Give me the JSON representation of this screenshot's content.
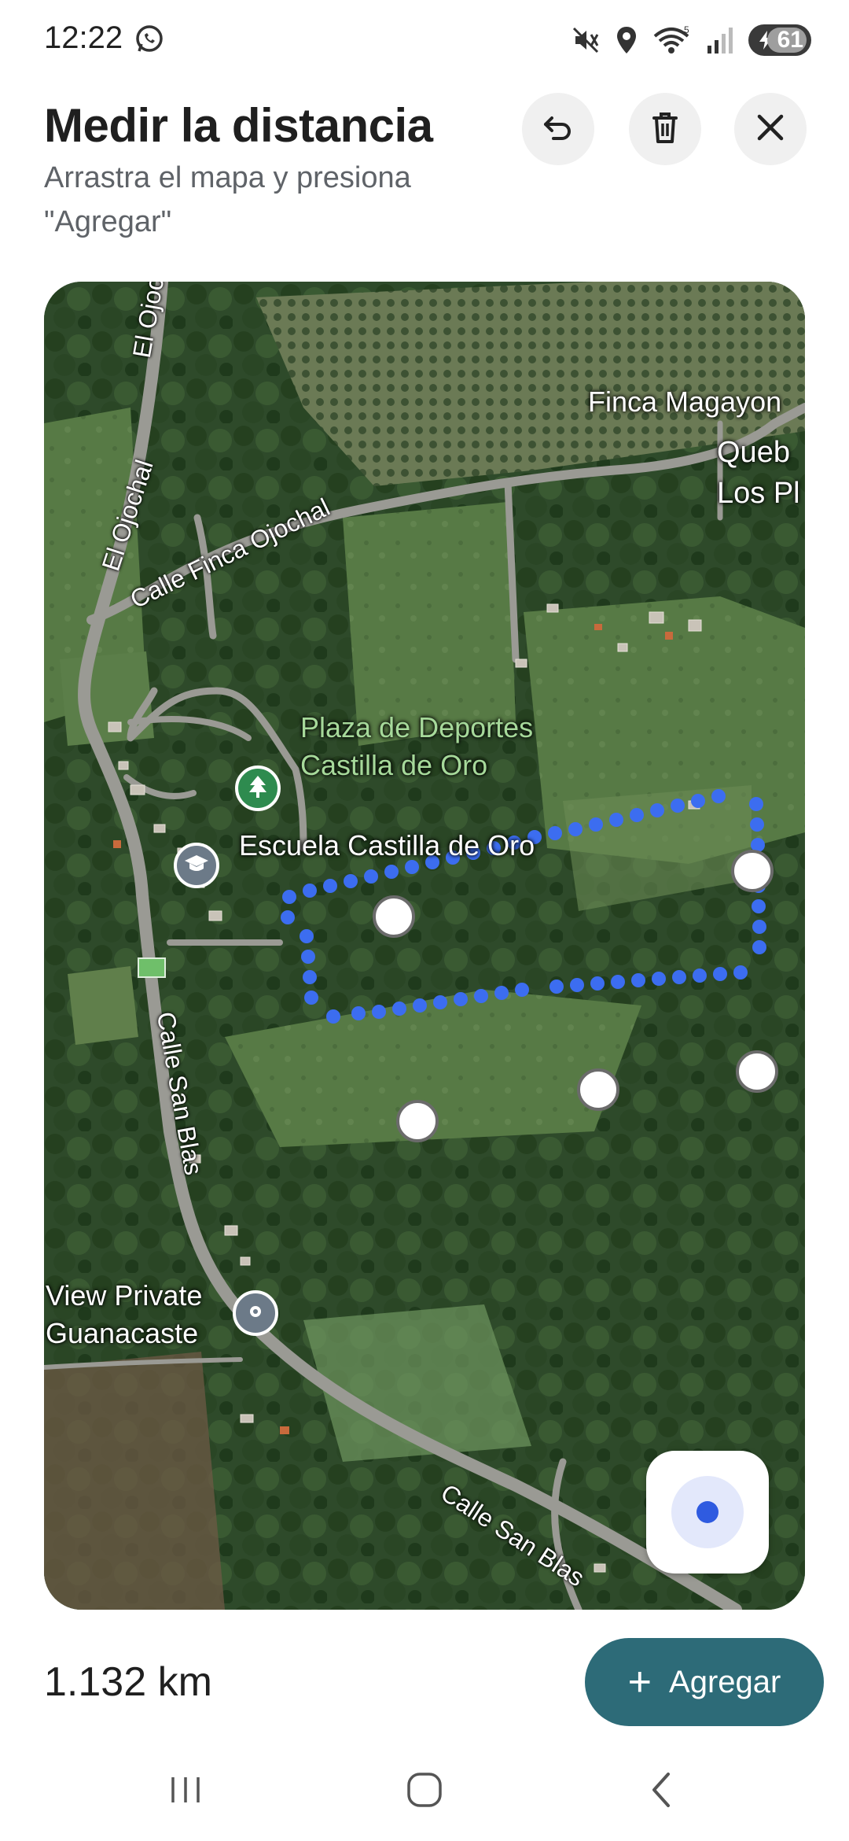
{
  "status_bar": {
    "time": "12:22",
    "battery": "61",
    "icons": [
      "whatsapp-icon",
      "mute-icon",
      "location-icon",
      "wifi-icon",
      "signal-icon",
      "battery-icon"
    ]
  },
  "header": {
    "title": "Medir la distancia",
    "subtitle": "Arrastra el mapa y presiona \"Agregar\""
  },
  "map": {
    "labels": {
      "finca_magayon": "Finca Magayon",
      "queb": "Queb",
      "los_pl": "Los Pl",
      "plaza_line1": "Plaza de Deportes",
      "plaza_line2": "Castilla de Oro",
      "escuela": "Escuela Castilla de Oro",
      "view_line1": "View Private",
      "view_line2": "Guanacaste"
    },
    "roads": {
      "el_ojochal_top": "El Ojoc",
      "el_ojochal": "El Ojochal",
      "calle_finca_ojochal": "Calle Finca Ojochal",
      "calle_san_blas_1": "Calle San Blas",
      "calle_san_blas_2": "Calle San Blas"
    }
  },
  "measurement": {
    "distance": "1.132 km",
    "add_label": "Agregar"
  },
  "colors": {
    "accent": "#2d6b78",
    "path": "#3c6df0"
  }
}
